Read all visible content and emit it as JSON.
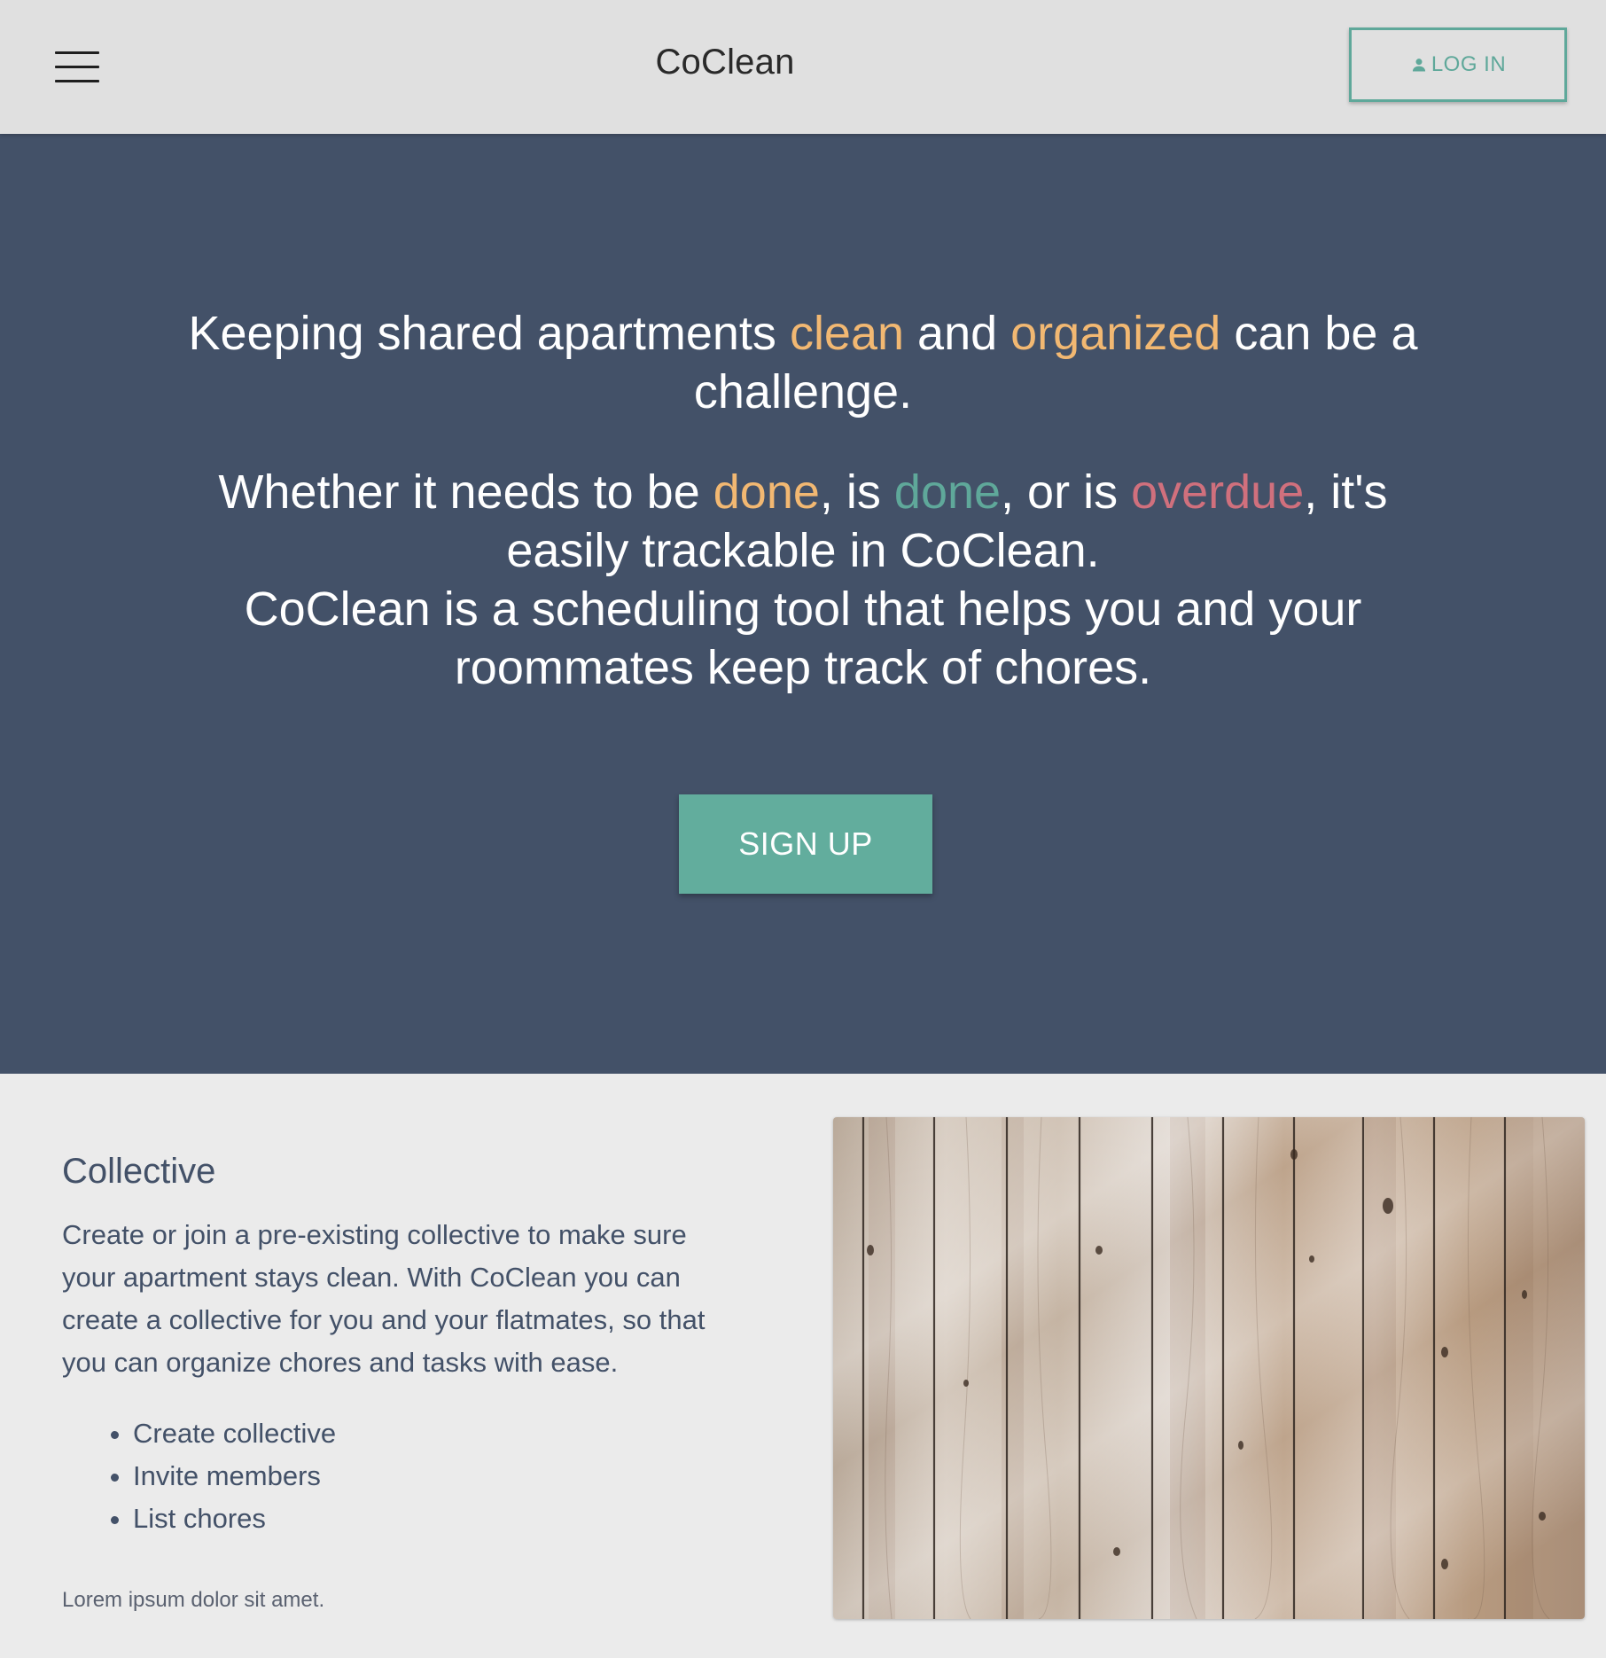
{
  "header": {
    "menu_icon": "hamburger-menu-icon",
    "brand": "CoClean",
    "login_icon": "person-icon",
    "login_label": "LOG IN"
  },
  "hero": {
    "line1": {
      "part1": "Keeping shared apartments ",
      "highlight1": "clean",
      "part2": " and ",
      "highlight2": "organized",
      "part3": " can be a challenge."
    },
    "line2": {
      "part1": "Whether it needs to be ",
      "status_todo": "done",
      "part2": ", is ",
      "status_done": "done",
      "part3": ", or is ",
      "status_overdue": "overdue",
      "part4": ", it's easily trackable in CoClean.",
      "part5": "CoClean is a scheduling tool that helps you and your roommates keep track of chores."
    },
    "signup_label": "SIGN UP"
  },
  "feature": {
    "title": "Collective",
    "text": "Create or join a pre-existing collective to make sure your apartment stays clean. With CoClean you can create a collective for you and your flatmates, so that you can organize chores and tasks with ease.",
    "list": [
      "Create collective",
      "Invite members",
      "List chores"
    ],
    "note": "Lorem ipsum dolor sit amet."
  },
  "colors": {
    "header_bg": "#e0e0e0",
    "hero_bg": "#435168",
    "accent_green": "#5fa89a",
    "accent_yellow": "#f2b872",
    "accent_red": "#d0707d",
    "feature_bg": "#ebebeb"
  }
}
